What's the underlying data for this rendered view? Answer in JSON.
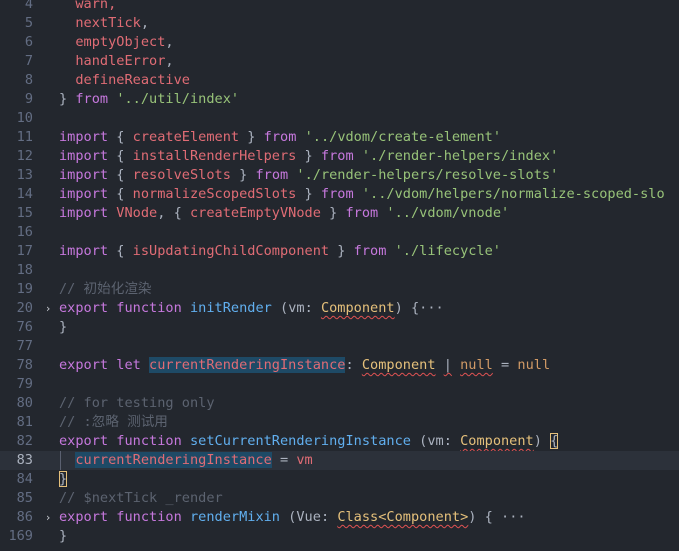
{
  "lines": [
    {
      "num": "4",
      "tokens": [
        {
          "t": "  ",
          "c": ""
        },
        {
          "t": "warn,",
          "c": "t-var"
        }
      ]
    },
    {
      "num": "5",
      "tokens": [
        {
          "t": "  ",
          "c": ""
        },
        {
          "t": "nextTick",
          "c": "t-var"
        },
        {
          "t": ",",
          "c": "t-punc"
        }
      ]
    },
    {
      "num": "6",
      "tokens": [
        {
          "t": "  ",
          "c": ""
        },
        {
          "t": "emptyObject",
          "c": "t-var"
        },
        {
          "t": ",",
          "c": "t-punc"
        }
      ]
    },
    {
      "num": "7",
      "tokens": [
        {
          "t": "  ",
          "c": ""
        },
        {
          "t": "handleError",
          "c": "t-var"
        },
        {
          "t": ",",
          "c": "t-punc"
        }
      ]
    },
    {
      "num": "8",
      "tokens": [
        {
          "t": "  ",
          "c": ""
        },
        {
          "t": "defineReactive",
          "c": "t-var"
        }
      ]
    },
    {
      "num": "9",
      "tokens": [
        {
          "t": "} ",
          "c": "t-punc"
        },
        {
          "t": "from",
          "c": "t-kw"
        },
        {
          "t": " ",
          "c": ""
        },
        {
          "t": "'../util/index'",
          "c": "t-str"
        }
      ]
    },
    {
      "num": "10",
      "tokens": []
    },
    {
      "num": "11",
      "tokens": [
        {
          "t": "import",
          "c": "t-kw"
        },
        {
          "t": " { ",
          "c": "t-punc"
        },
        {
          "t": "createElement",
          "c": "t-var"
        },
        {
          "t": " } ",
          "c": "t-punc"
        },
        {
          "t": "from",
          "c": "t-kw"
        },
        {
          "t": " ",
          "c": ""
        },
        {
          "t": "'../vdom/create-element'",
          "c": "t-str"
        }
      ]
    },
    {
      "num": "12",
      "tokens": [
        {
          "t": "import",
          "c": "t-kw"
        },
        {
          "t": " { ",
          "c": "t-punc"
        },
        {
          "t": "installRenderHelpers",
          "c": "t-var"
        },
        {
          "t": " } ",
          "c": "t-punc"
        },
        {
          "t": "from",
          "c": "t-kw"
        },
        {
          "t": " ",
          "c": ""
        },
        {
          "t": "'./render-helpers/index'",
          "c": "t-str"
        }
      ]
    },
    {
      "num": "13",
      "tokens": [
        {
          "t": "import",
          "c": "t-kw"
        },
        {
          "t": " { ",
          "c": "t-punc"
        },
        {
          "t": "resolveSlots",
          "c": "t-var"
        },
        {
          "t": " } ",
          "c": "t-punc"
        },
        {
          "t": "from",
          "c": "t-kw"
        },
        {
          "t": " ",
          "c": ""
        },
        {
          "t": "'./render-helpers/resolve-slots'",
          "c": "t-str"
        }
      ]
    },
    {
      "num": "14",
      "tokens": [
        {
          "t": "import",
          "c": "t-kw"
        },
        {
          "t": " { ",
          "c": "t-punc"
        },
        {
          "t": "normalizeScopedSlots",
          "c": "t-var"
        },
        {
          "t": " } ",
          "c": "t-punc"
        },
        {
          "t": "from",
          "c": "t-kw"
        },
        {
          "t": " ",
          "c": ""
        },
        {
          "t": "'../vdom/helpers/normalize-scoped-slo",
          "c": "t-str"
        }
      ]
    },
    {
      "num": "15",
      "tokens": [
        {
          "t": "import",
          "c": "t-kw"
        },
        {
          "t": " ",
          "c": ""
        },
        {
          "t": "VNode",
          "c": "t-var"
        },
        {
          "t": ", { ",
          "c": "t-punc"
        },
        {
          "t": "createEmptyVNode",
          "c": "t-var"
        },
        {
          "t": " } ",
          "c": "t-punc"
        },
        {
          "t": "from",
          "c": "t-kw"
        },
        {
          "t": " ",
          "c": ""
        },
        {
          "t": "'../vdom/vnode'",
          "c": "t-str"
        }
      ]
    },
    {
      "num": "16",
      "tokens": []
    },
    {
      "num": "17",
      "tokens": [
        {
          "t": "import",
          "c": "t-kw"
        },
        {
          "t": " { ",
          "c": "t-punc"
        },
        {
          "t": "isUpdatingChildComponent",
          "c": "t-var"
        },
        {
          "t": " } ",
          "c": "t-punc"
        },
        {
          "t": "from",
          "c": "t-kw"
        },
        {
          "t": " ",
          "c": ""
        },
        {
          "t": "'./lifecycle'",
          "c": "t-str"
        }
      ]
    },
    {
      "num": "18",
      "tokens": []
    },
    {
      "num": "19",
      "tokens": [
        {
          "t": "// 初始化渲染",
          "c": "t-cm"
        }
      ]
    },
    {
      "num": "20",
      "fold": true,
      "tokens": [
        {
          "t": "export",
          "c": "t-kw"
        },
        {
          "t": " ",
          "c": ""
        },
        {
          "t": "function",
          "c": "t-kw"
        },
        {
          "t": " ",
          "c": ""
        },
        {
          "t": "initRender",
          "c": "t-fn"
        },
        {
          "t": " (",
          "c": "t-punc"
        },
        {
          "t": "vm",
          "c": "t-punc"
        },
        {
          "t": ": ",
          "c": "t-punc"
        },
        {
          "t": "Component",
          "c": "t-type squig"
        },
        {
          "t": ") {",
          "c": "t-punc"
        },
        {
          "t": "···",
          "c": "t-dots"
        }
      ]
    },
    {
      "num": "76",
      "tokens": [
        {
          "t": "}",
          "c": "t-punc"
        }
      ]
    },
    {
      "num": "77",
      "tokens": []
    },
    {
      "num": "78",
      "tokens": [
        {
          "t": "export",
          "c": "t-kw"
        },
        {
          "t": " ",
          "c": ""
        },
        {
          "t": "let",
          "c": "t-kw"
        },
        {
          "t": " ",
          "c": ""
        },
        {
          "t": "currentRenderingInstance",
          "c": "t-var hl"
        },
        {
          "t": ": ",
          "c": "t-punc"
        },
        {
          "t": "Component",
          "c": "t-type squig"
        },
        {
          "t": " ",
          "c": ""
        },
        {
          "t": "|",
          "c": "t-punc squig"
        },
        {
          "t": " ",
          "c": ""
        },
        {
          "t": "null",
          "c": "t-amp squig"
        },
        {
          "t": " = ",
          "c": "t-punc"
        },
        {
          "t": "null",
          "c": "t-amp"
        }
      ]
    },
    {
      "num": "79",
      "tokens": []
    },
    {
      "num": "80",
      "tokens": [
        {
          "t": "// for testing only",
          "c": "t-cm"
        }
      ]
    },
    {
      "num": "81",
      "tokens": [
        {
          "t": "// :忽略 测试用",
          "c": "t-cm"
        }
      ]
    },
    {
      "num": "82",
      "tokens": [
        {
          "t": "export",
          "c": "t-kw"
        },
        {
          "t": " ",
          "c": ""
        },
        {
          "t": "function",
          "c": "t-kw"
        },
        {
          "t": " ",
          "c": ""
        },
        {
          "t": "setCurrentRenderingInstance",
          "c": "t-fn"
        },
        {
          "t": " (",
          "c": "t-punc"
        },
        {
          "t": "vm",
          "c": "t-punc"
        },
        {
          "t": ": ",
          "c": "t-punc"
        },
        {
          "t": "Component",
          "c": "t-type squig"
        },
        {
          "t": ") ",
          "c": "t-punc"
        },
        {
          "t": "{",
          "c": "t-punc bracket-hl-y"
        }
      ]
    },
    {
      "num": "83",
      "current": true,
      "guide": true,
      "tokens": [
        {
          "t": "  ",
          "c": ""
        },
        {
          "t": "currentRenderingInstance",
          "c": "t-var hl"
        },
        {
          "t": " = ",
          "c": "t-punc"
        },
        {
          "t": "vm",
          "c": "t-var"
        }
      ]
    },
    {
      "num": "84",
      "tokens": [
        {
          "t": "}",
          "c": "t-punc bracket-hl-y"
        }
      ]
    },
    {
      "num": "85",
      "tokens": [
        {
          "t": "// $nextTick _render",
          "c": "t-cm"
        }
      ]
    },
    {
      "num": "86",
      "fold": true,
      "tokens": [
        {
          "t": "export",
          "c": "t-kw"
        },
        {
          "t": " ",
          "c": ""
        },
        {
          "t": "function",
          "c": "t-kw"
        },
        {
          "t": " ",
          "c": ""
        },
        {
          "t": "renderMixin",
          "c": "t-fn"
        },
        {
          "t": " (",
          "c": "t-punc"
        },
        {
          "t": "Vue",
          "c": "t-punc"
        },
        {
          "t": ": ",
          "c": "t-punc"
        },
        {
          "t": "Class<Component>",
          "c": "t-type squig"
        },
        {
          "t": ") {",
          "c": "t-punc"
        },
        {
          "t": " ···",
          "c": "t-dots"
        }
      ]
    },
    {
      "num": "169",
      "tokens": [
        {
          "t": "}",
          "c": "t-punc"
        }
      ]
    }
  ],
  "icons": {
    "fold": "›"
  }
}
